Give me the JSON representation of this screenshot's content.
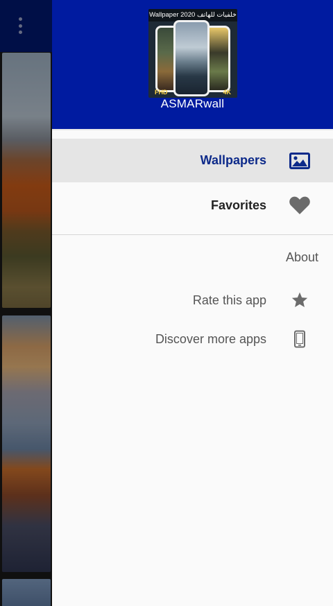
{
  "background": {
    "overflow_icon": "more-vert-icon"
  },
  "drawer": {
    "header": {
      "logo_caption": "Wallpaper 2020 خلفيات للهاتف",
      "logo_badge_left": "FHD",
      "logo_badge_right": "4K",
      "app_name": "ASMARwall",
      "bg_color": "#001ba0"
    },
    "items": [
      {
        "label": "Wallpapers",
        "icon": "image-icon",
        "selected": true
      },
      {
        "label": "Favorites",
        "icon": "heart-icon",
        "selected": false
      }
    ],
    "section": {
      "title": "About",
      "items": [
        {
          "label": "Rate this app",
          "icon": "star-icon"
        },
        {
          "label": "Discover more apps",
          "icon": "smartphone-icon"
        }
      ]
    }
  },
  "colors": {
    "accent": "#0d2a8a",
    "selected_bg": "#e5e5e5",
    "icon_gray": "#6b6b6b"
  }
}
